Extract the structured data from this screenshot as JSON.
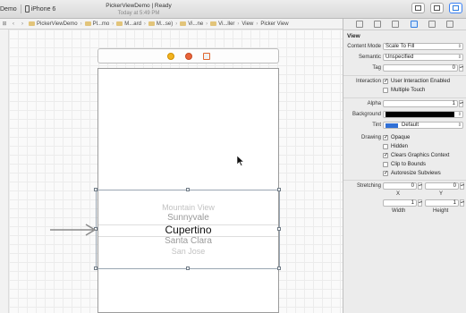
{
  "toolbar": {
    "scheme_name": "Demo",
    "device": "iPhone 6",
    "status_line1": "PickerViewDemo | Ready",
    "status_line2": "Today at 5:49 PM"
  },
  "jumpbar": {
    "crumbs": [
      "PickerViewDemo",
      "Pl...mo",
      "M...ard",
      "M...se)",
      "Vi...ne",
      "Vi...ller",
      "View",
      "Picker View"
    ]
  },
  "picker": {
    "rows": [
      "Mountain View",
      "Sunnyvale",
      "Cupertino",
      "Santa Clara",
      "San Jose"
    ]
  },
  "inspector": {
    "section": "View",
    "content_mode": {
      "label": "Content Mode",
      "value": "Scale To Fill"
    },
    "semantic": {
      "label": "Semantic",
      "value": "Unspecified"
    },
    "tag": {
      "label": "Tag",
      "value": "0"
    },
    "interaction": {
      "label": "Interaction",
      "options": [
        {
          "label": "User Interaction Enabled",
          "checked": true
        },
        {
          "label": "Multiple Touch",
          "checked": false
        }
      ]
    },
    "alpha": {
      "label": "Alpha",
      "value": "1"
    },
    "background": {
      "label": "Background"
    },
    "tint": {
      "label": "Tint",
      "value": "Default"
    },
    "drawing": {
      "label": "Drawing",
      "options": [
        {
          "label": "Opaque",
          "checked": true
        },
        {
          "label": "Hidden",
          "checked": false
        },
        {
          "label": "Clears Graphics Context",
          "checked": true
        },
        {
          "label": "Clip to Bounds",
          "checked": false
        },
        {
          "label": "Autoresize Subviews",
          "checked": true
        }
      ]
    },
    "stretching": {
      "label": "Stretching",
      "x": "0",
      "y": "0",
      "width": "1",
      "height": "1",
      "x_label": "X",
      "y_label": "Y",
      "width_label": "Width",
      "height_label": "Height"
    }
  },
  "colors": {
    "accent": "#2f7de1",
    "tint": "#2f6fd6",
    "background_swatch": "#000000"
  }
}
